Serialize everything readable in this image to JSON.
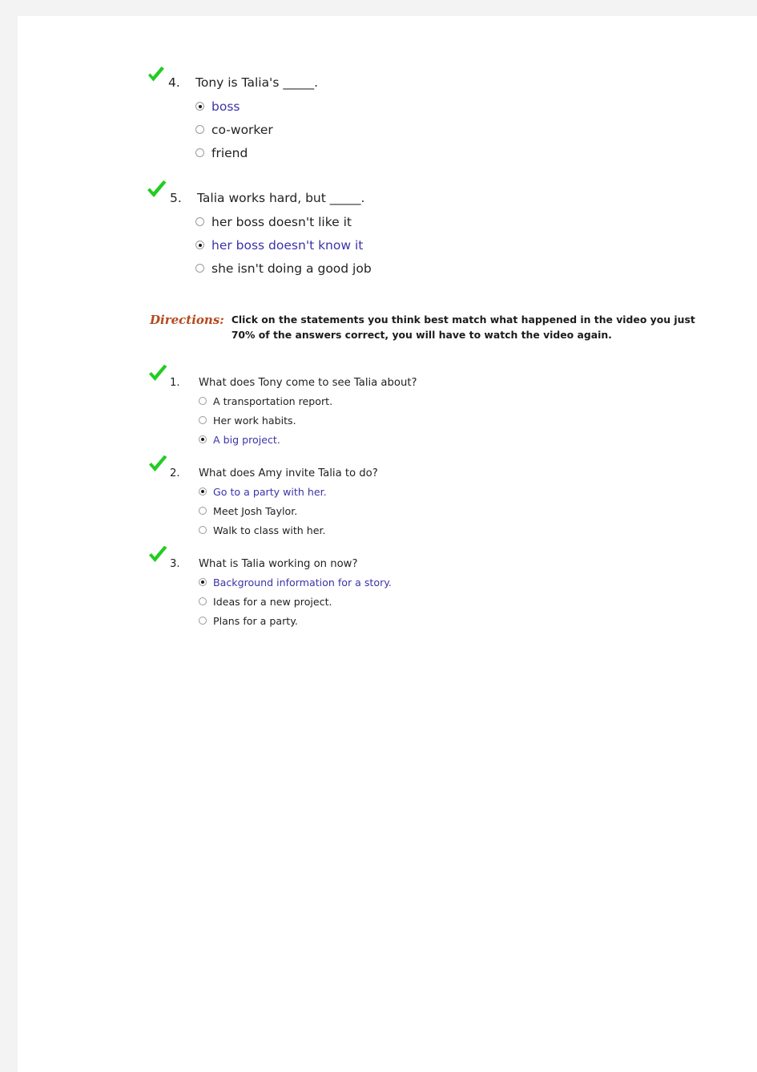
{
  "theme": {
    "page_background": "#f3f3f3",
    "sheet_background": "#ffffff",
    "text_color": "#222222",
    "selected_answer_color": "#3b34a8",
    "checkmark_color": "#22cc22",
    "directions_label_color": "#b5491c"
  },
  "top_section": {
    "questions": [
      {
        "number": "4.",
        "text": "Tony is Talia's _____.",
        "clipped": true,
        "graded_icon": "green-check-icon",
        "options": [
          {
            "label": "boss",
            "selected": true
          },
          {
            "label": "co-worker",
            "selected": false
          },
          {
            "label": "friend",
            "selected": false
          }
        ]
      },
      {
        "number": "5.",
        "text": "Talia works hard, but _____.",
        "clipped": false,
        "graded_icon": "green-check-icon",
        "options": [
          {
            "label": "her boss doesn't like it",
            "selected": false
          },
          {
            "label": "her boss doesn't know it",
            "selected": true
          },
          {
            "label": "she isn't doing a good job",
            "selected": false
          }
        ]
      }
    ]
  },
  "directions": {
    "label": "Directions:",
    "line1": "Click on the statements you think best match what happened in the video you just",
    "line2": "70% of the answers correct, you will have to watch the video again."
  },
  "bottom_section": {
    "questions": [
      {
        "number": "1.",
        "text": "What does Tony come to see Talia about?",
        "graded_icon": "green-check-icon",
        "options": [
          {
            "label": "A transportation report.",
            "selected": false
          },
          {
            "label": "Her work habits.",
            "selected": false
          },
          {
            "label": "A big project.",
            "selected": true
          }
        ]
      },
      {
        "number": "2.",
        "text": "What does Amy invite Talia to do?",
        "graded_icon": "green-check-icon",
        "options": [
          {
            "label": "Go to a party with her.",
            "selected": true
          },
          {
            "label": "Meet Josh Taylor.",
            "selected": false
          },
          {
            "label": "Walk to class with her.",
            "selected": false
          }
        ]
      },
      {
        "number": "3.",
        "text": "What is Talia working on now?",
        "graded_icon": "green-check-icon",
        "options": [
          {
            "label": "Background information for a story.",
            "selected": true
          },
          {
            "label": "Ideas for a new project.",
            "selected": false
          },
          {
            "label": "Plans for a party.",
            "selected": false
          }
        ]
      }
    ]
  }
}
